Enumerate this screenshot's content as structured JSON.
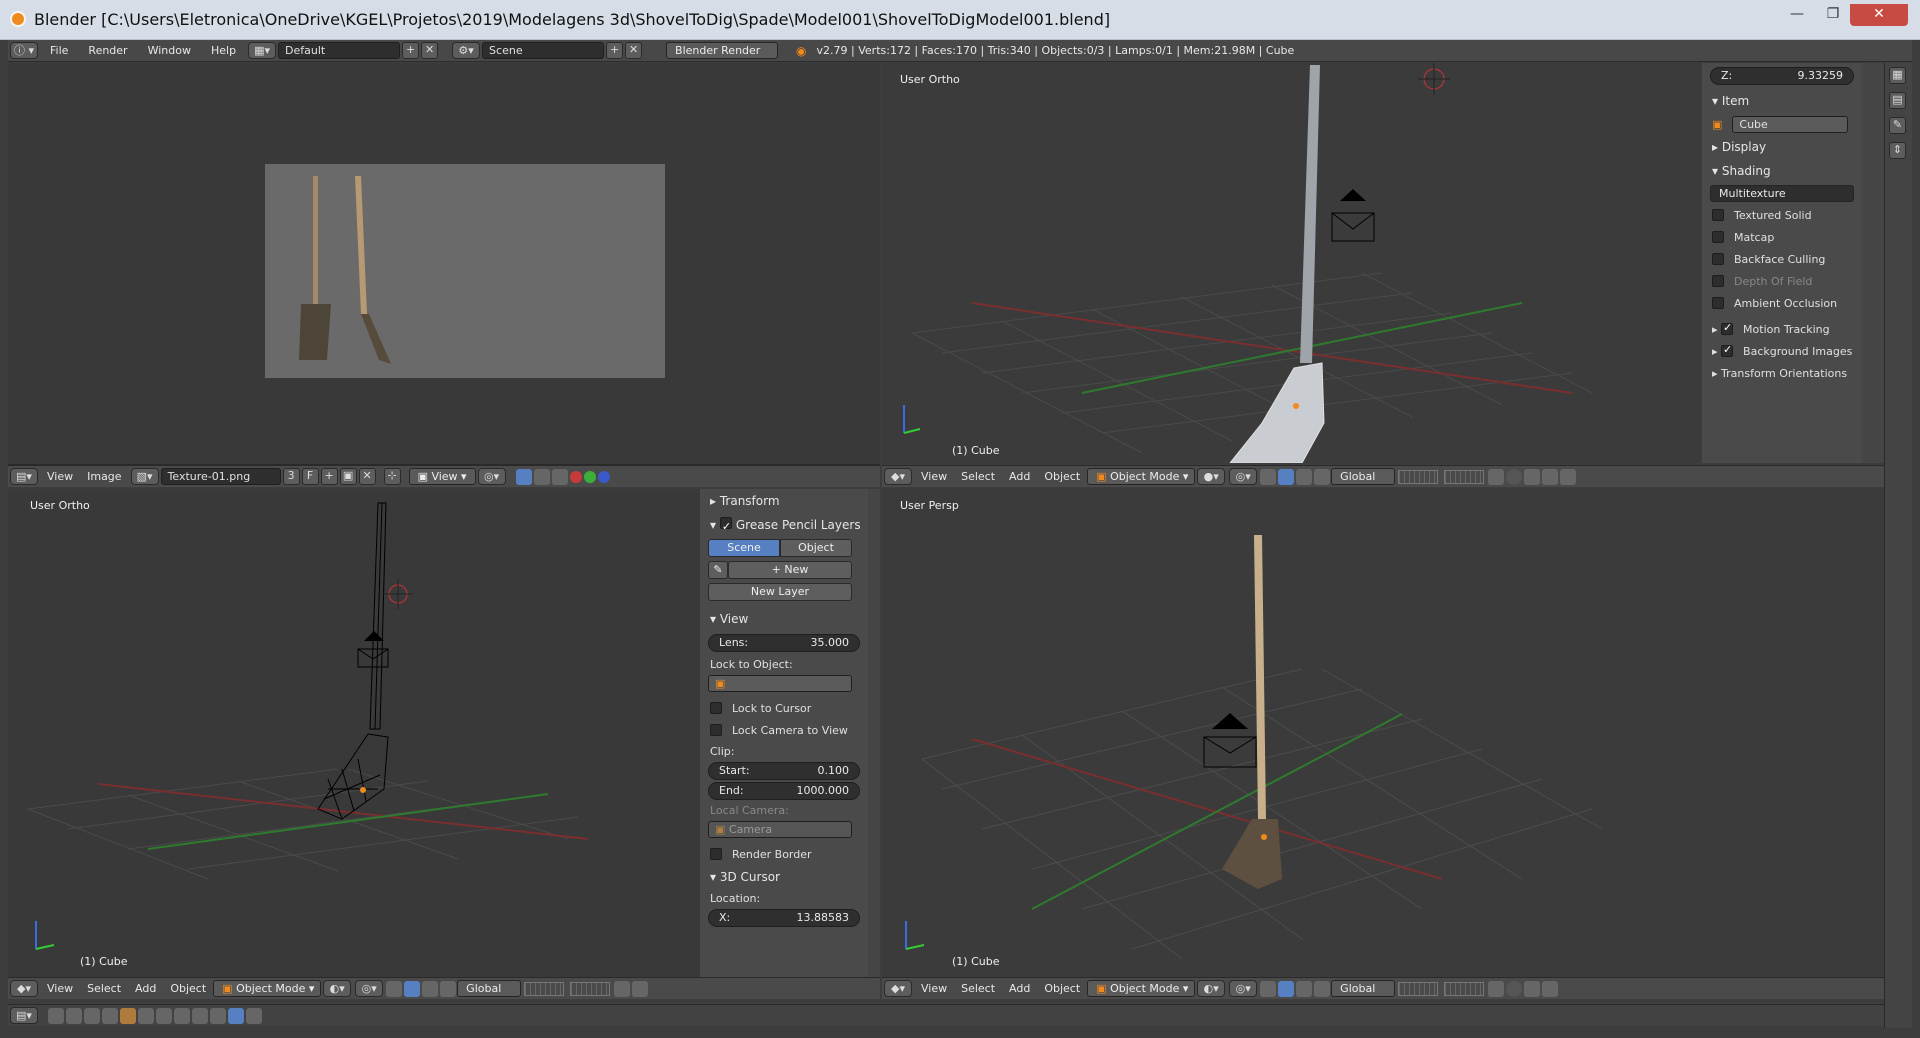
{
  "window": {
    "title": "Blender  [C:\\Users\\Eletronica\\OneDrive\\KGEL\\Projetos\\2019\\Modelagens 3d\\ShovelToDig\\Spade\\Model001\\ShovelToDigModel001.blend]",
    "min": "—",
    "max": "❐",
    "close": "✕"
  },
  "topbar": {
    "menus": [
      "File",
      "Render",
      "Window",
      "Help"
    ],
    "layout": "Default",
    "scene": "Scene",
    "engine": "Blender Render",
    "stats": "v2.79 | Verts:172 | Faces:170 | Tris:340 | Objects:0/3 | Lamps:0/1 | Mem:21.98M | Cube"
  },
  "image_editor": {
    "menus": [
      "View",
      "Image"
    ],
    "image_name": "Texture-01.png",
    "users": "3",
    "fake": "F",
    "view": "View"
  },
  "viewport_tr": {
    "label": "User Ortho",
    "object": "(1) Cube"
  },
  "viewport_bl": {
    "label": "User Ortho",
    "object": "(1) Cube"
  },
  "viewport_br": {
    "label": "User Persp",
    "object": "(1) Cube"
  },
  "header3d": {
    "menus": [
      "View",
      "Select",
      "Add",
      "Object"
    ],
    "mode": "Object Mode",
    "orientation": "Global"
  },
  "props_panel": {
    "z_label": "Z:",
    "z_value": "9.33259",
    "item": "Item",
    "item_name": "Cube",
    "display": "Display",
    "shading": "Shading",
    "shading_mode": "Multitexture",
    "options": [
      "Textured Solid",
      "Matcap",
      "Backface Culling",
      "Depth Of Field",
      "Ambient Occlusion"
    ],
    "motion_tracking": "Motion Tracking",
    "background_images": "Background Images",
    "transform_orientations": "Transform Orientations"
  },
  "tool_panel": {
    "transform": "Transform",
    "grease": "Grease Pencil Layers",
    "tab_scene": "Scene",
    "tab_object": "Object",
    "new": "New",
    "new_layer": "New Layer",
    "view": "View",
    "lens_label": "Lens:",
    "lens_value": "35.000",
    "lock_to_object": "Lock to Object:",
    "lock_cursor": "Lock to Cursor",
    "lock_camera": "Lock Camera to View",
    "clip": "Clip:",
    "start_label": "Start:",
    "start_value": "0.100",
    "end_label": "End:",
    "end_value": "1000.000",
    "local_camera": "Local Camera:",
    "camera": "Camera",
    "render_border": "Render Border",
    "cursor3d": "3D Cursor",
    "location": "Location:",
    "x_label": "X:",
    "x_value": "13.88583"
  },
  "colors": {
    "accent": "#5680c2",
    "grid_red": "#8a3434",
    "grid_green": "#3d8a3d",
    "orange": "#f08a1c"
  }
}
